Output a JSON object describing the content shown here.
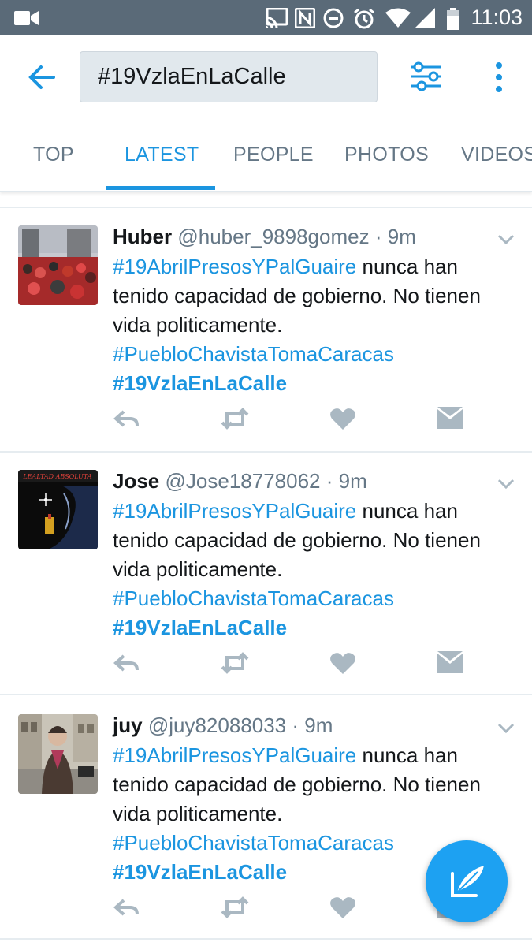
{
  "status_bar": {
    "time": "11:03"
  },
  "search": {
    "query": "#19VzlaEnLaCalle"
  },
  "tabs": [
    {
      "label": "TOP"
    },
    {
      "label": "LATEST"
    },
    {
      "label": "PEOPLE"
    },
    {
      "label": "PHOTOS"
    },
    {
      "label": "VIDEOS"
    }
  ],
  "active_tab": "LATEST",
  "tweets": [
    {
      "name": "Huber",
      "handle": "@huber_9898gomez",
      "sep": "·",
      "time": "9m",
      "hashtag1": "#19AbrilPresosYPalGuaire",
      "text": "nunca han tenido capacidad de gobierno. No tienen vida politicamente.",
      "hashtag2": "#PuebloChavistaTomaCaracas",
      "hashtag3": "#19VzlaEnLaCalle"
    },
    {
      "name": "Jose",
      "handle": "@Jose18778062",
      "sep": "·",
      "time": "9m",
      "hashtag1": "#19AbrilPresosYPalGuaire",
      "text": "nunca han tenido capacidad de gobierno. No tienen vida politicamente.",
      "hashtag2": "#PuebloChavistaTomaCaracas",
      "hashtag3": "#19VzlaEnLaCalle",
      "avatar_text": "LEALTAD ABSOLUTA"
    },
    {
      "name": "juy",
      "handle": "@juy82088033",
      "sep": "·",
      "time": "9m",
      "hashtag1": "#19AbrilPresosYPalGuaire",
      "text": "nunca han tenido capacidad de gobierno. No tienen vida politicamente.",
      "hashtag2": "#PuebloChavistaTomaCaracas",
      "hashtag3": "#19VzlaEnLaCalle"
    }
  ],
  "colors": {
    "accent": "#1b95e0",
    "statusbar": "#5a6a78",
    "icon_gray": "#aab8c2"
  },
  "icons": [
    "back-arrow-icon",
    "filter-icon",
    "more-vert-icon",
    "chevron-down-icon",
    "reply-icon",
    "retweet-icon",
    "like-icon",
    "direct-message-icon",
    "compose-icon"
  ]
}
